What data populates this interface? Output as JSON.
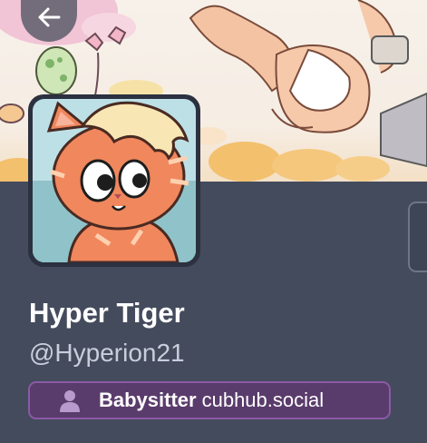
{
  "profile": {
    "display_name": "Hyper Tiger",
    "handle": "@Hyperion21",
    "role": {
      "name": "Babysitter",
      "server": "cubhub.social",
      "color": "#8a5aa5"
    }
  },
  "icons": {
    "back": "arrow-left-icon",
    "role": "person-icon"
  },
  "colors": {
    "background": "#444b5d",
    "text_primary": "#ffffff",
    "text_secondary": "#c9cedb",
    "role_badge_bg": "#5a3c6c"
  }
}
